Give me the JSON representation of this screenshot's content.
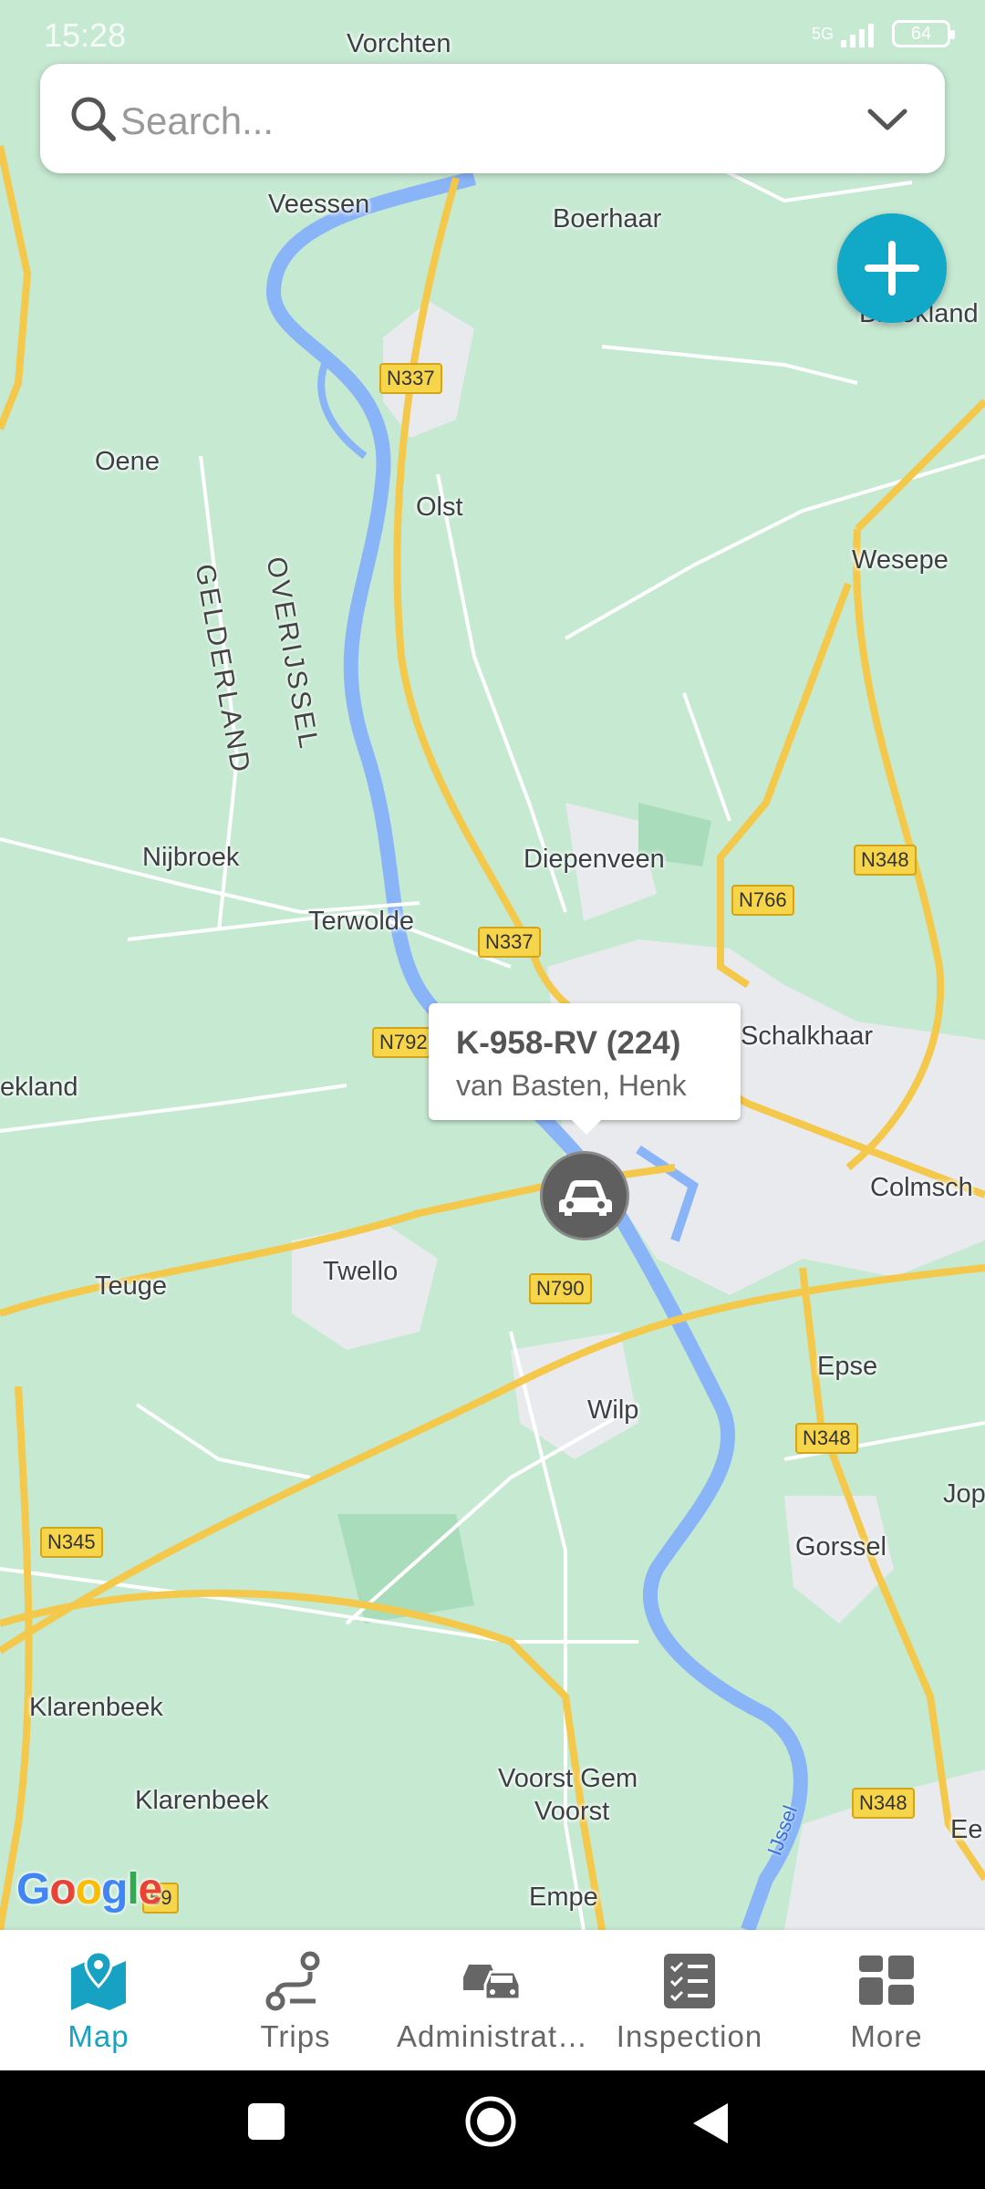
{
  "status_bar": {
    "time": "15:28",
    "network": "5G",
    "battery": "64"
  },
  "search": {
    "placeholder": "Search..."
  },
  "map": {
    "places": [
      "Vorchten",
      "Veessen",
      "Boerhaar",
      "Broekland",
      "Oene",
      "Olst",
      "Wesepe",
      "Nijbroek",
      "Diepenveen",
      "Terwolde",
      "Schalkhaar",
      "ekland",
      "Colmsch",
      "Teuge",
      "Twello",
      "Epse",
      "Wilp",
      "Jop",
      "Gorssel",
      "Klarenbeek",
      "Klarenbeek",
      "Voorst Gem",
      "Voorst",
      "Empe",
      "Ee"
    ],
    "provinces": [
      "GELDERLAND",
      "OVERIJSSEL"
    ],
    "river": "IJssel",
    "roads": [
      "N337",
      "N337",
      "N348",
      "N766",
      "N792",
      "N790",
      "N348",
      "N345",
      "N348",
      "59"
    ]
  },
  "vehicle": {
    "title": "K-958-RV (224)",
    "driver": "van Basten, Henk"
  },
  "google_logo": "Google",
  "nav": {
    "items": [
      {
        "label": "Map",
        "icon": "map-pin-icon"
      },
      {
        "label": "Trips",
        "icon": "route-icon"
      },
      {
        "label": "Administrat…",
        "icon": "cars-icon"
      },
      {
        "label": "Inspection",
        "icon": "checklist-icon"
      },
      {
        "label": "More",
        "icon": "grid-icon"
      }
    ]
  },
  "colors": {
    "accent": "#17a2c4",
    "fab": "#12a8c8",
    "map_green": "#c6e9d2",
    "road": "#f7d54b"
  }
}
